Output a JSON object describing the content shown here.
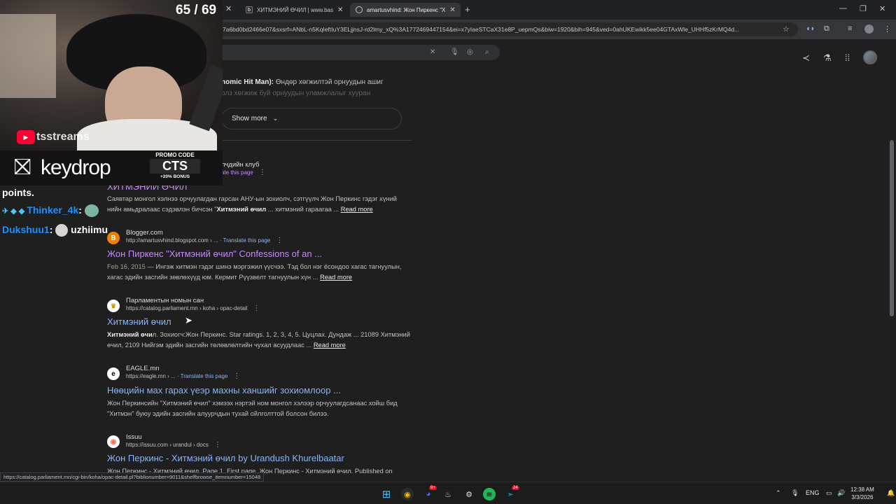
{
  "browser": {
    "tabs": [
      {
        "label": "ХИТМЭНИЙ ӨЧИЛ | www.bas",
        "favicon": "b"
      },
      {
        "label": "amartusvhind: Жон Пиркенс \"Х",
        "favicon": "g"
      }
    ],
    "new_tab": "+",
    "url": "7a6bd0bd2466e07&sxsrf=ANbL-n5KqIeftIuY3ELjjnsJ-rd2lmy_xQ%3A1772469447154&ei=x7yIaeSTCaX31e8P_uepmQs&biw=1920&bih=945&ved=0ahUKEwikk5ee04GTAxWle_UHHf5zKrMQ4d...",
    "status_url": "https://catalog.parliament.mn/cgi-bin/koha/opac-detail.pl?biblionumber=9011&shelfbrowse_itemnumber=15048"
  },
  "top_snippet": {
    "title_part": "nomic Hit Man):",
    "text": "Өндөр хөгжилтэй орнуудын ашиг",
    "faded": "олз хөгжиж буй орнуудын уламжлалыг хууран"
  },
  "show_more": "Show more",
  "results": [
    {
      "site": "лчдийн клуб",
      "translate": "ate this page",
      "title": "ХИТМЭНИЙ ӨЧИЛ",
      "desc_pre": "Саявтар монгол хэлнээ орчуулагдан гарсан АНУ-ын зохиолч, сэтгүүлч Жон Перкинс гэдэг хүний",
      "desc_pre2": "нийн амьдралаас сэдэвлэн бичсэн \"",
      "desc_bold": "Хитмэний өчил",
      "desc_post": " ... хитмэний гараагаа ...",
      "read_more": "Read more"
    },
    {
      "site": "Blogger.com",
      "url": "http://amartusvhind.blogspot.com › ...",
      "translate": "· Translate this page",
      "title": "Жон Пиркенс \"Хитмэний өчил\" Confessions of an ...",
      "date": "Feb 16, 2015",
      "desc": " — Ингэж хитмэн гэдэг шинэ мэргэжил үүсчээ. Тэд бол нэг ёсондоо хагас тагнуулын,",
      "desc2": "хагас эдийн засгийн зөвлөхүүд юм. Кермит Рүүзвелт тагнуулын хүн ...",
      "read_more": "Read more"
    },
    {
      "site": "Парламентын номын сан",
      "url": "https://catalog.parliament.mn › koha › opac-detail",
      "title": "Хитмэний өчил",
      "desc_bold": "Хитмэний өчи",
      "desc": "л. Зохиогч:Жон Перкинс. Star ratings. 1, 2, 3, 4, 5. Цуцлах. Дундаж ... 21089 Хитмэний",
      "desc2": "өчил, 2109 Нийгэм эдийн засгийн төлөвлөлтийн чухал асуудлаас ...",
      "read_more": "Read more"
    },
    {
      "site": "EAGLE.mn",
      "url": "https://eagle.mn › ...",
      "translate": "· Translate this page",
      "title": "Нөөцийн мах гарах үеэр махны ханшийг зохиомлоор ...",
      "desc": "Жон Перкинсийн \"Хитмэний өчил\" хэмээх нэртэй ном монгол хэлээр орчуулагдсанаас хойш бид",
      "desc2": "\"Хитмэн\" буюу эдийн засгийн алуурчдын тухай ойлголттой болсон билээ."
    },
    {
      "site": "Issuu",
      "url": "https://issuu.com › urandul › docs",
      "title": "Жон Перкинс - Хитмэний өчил by Urandush Khurelbaatar",
      "desc": "Жон Перкинс - Хитмэний өчил. Page 1. First page. Жон Перкинс - Хитмэний өчил. Published on"
    }
  ],
  "stream": {
    "counter": "65 / 69",
    "channel": "tsstreams",
    "sponsor": "keydrop",
    "promo_label": "PROMO CODE",
    "promo_code": "CTS",
    "promo_bonus": "+20% BONUS",
    "chat": [
      {
        "text": "points."
      },
      {
        "user": "Thinker_4k",
        "sep": ":"
      },
      {
        "user": "Dukshuu1",
        "sep": ":",
        "reply": "uzhiimu"
      }
    ]
  },
  "taskbar": {
    "lang": "ENG",
    "time": "12:38 AM",
    "date": "3/3/2026",
    "badge_discord": "9+",
    "badge_telegram": "24"
  },
  "colors": {
    "link": "#8ab4f8",
    "visited": "#c58af9",
    "bg": "#1f1f1f",
    "chat_user": "#1e90ff"
  }
}
